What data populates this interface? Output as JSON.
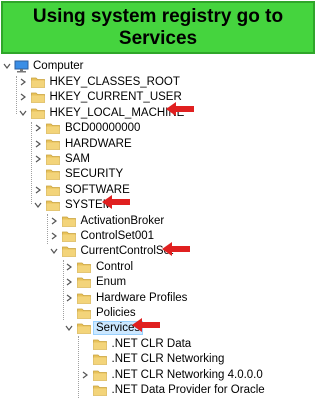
{
  "banner": {
    "title": "Using system registry go to Services"
  },
  "colors": {
    "banner_bg": "#45d43e",
    "folder": "#e8c25a",
    "arrow": "#e02020",
    "selected": "#cce8ff"
  },
  "tree": {
    "root": {
      "label": "Computer",
      "icon": "computer-icon"
    },
    "nodes": [
      {
        "label": "HKEY_CLASSES_ROOT",
        "state": "collapsed"
      },
      {
        "label": "HKEY_CURRENT_USER",
        "state": "collapsed"
      },
      {
        "label": "HKEY_LOCAL_MACHINE",
        "state": "expanded",
        "highlighted": true
      },
      {
        "label": "BCD00000000",
        "state": "collapsed"
      },
      {
        "label": "HARDWARE",
        "state": "collapsed"
      },
      {
        "label": "SAM",
        "state": "collapsed"
      },
      {
        "label": "SECURITY",
        "state": "leaf"
      },
      {
        "label": "SOFTWARE",
        "state": "collapsed"
      },
      {
        "label": "SYSTEM",
        "state": "expanded",
        "highlighted": true
      },
      {
        "label": "ActivationBroker",
        "state": "collapsed"
      },
      {
        "label": "ControlSet001",
        "state": "collapsed"
      },
      {
        "label": "CurrentControlSet",
        "state": "expanded",
        "highlighted": true
      },
      {
        "label": "Control",
        "state": "collapsed"
      },
      {
        "label": "Enum",
        "state": "collapsed"
      },
      {
        "label": "Hardware Profiles",
        "state": "collapsed"
      },
      {
        "label": "Policies",
        "state": "leaf"
      },
      {
        "label": "Services",
        "state": "expanded",
        "selected": true,
        "highlighted": true
      },
      {
        "label": ".NET CLR Data",
        "state": "leaf"
      },
      {
        "label": ".NET CLR Networking",
        "state": "leaf"
      },
      {
        "label": ".NET CLR Networking 4.0.0.0",
        "state": "collapsed"
      },
      {
        "label": ".NET Data Provider for Oracle",
        "state": "leaf"
      }
    ]
  }
}
